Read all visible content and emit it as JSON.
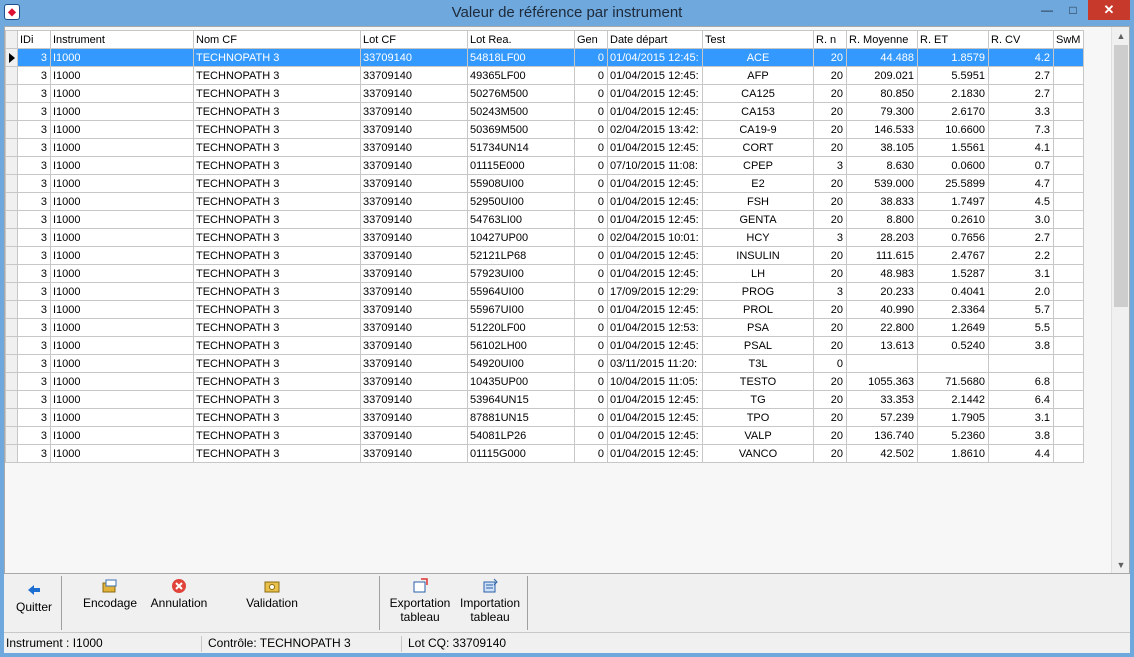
{
  "window": {
    "title": "Valeur de référence par instrument",
    "min_glyph": "—",
    "max_glyph": "□",
    "close_glyph": "✕"
  },
  "grid": {
    "columns": [
      "IDi",
      "Instrument",
      "Nom CF",
      "Lot CF",
      "Lot Rea.",
      "Gen",
      "Date départ",
      "Test",
      "R. n",
      "R. Moyenne",
      "R. ET",
      "R. CV",
      "SwM"
    ],
    "selected_row": 0,
    "rows": [
      [
        "3",
        "I1000",
        "TECHNOPATH 3",
        "33709140",
        "54818LF00",
        "0",
        "01/04/2015 12:45:",
        "ACE",
        "20",
        "44.488",
        "1.8579",
        "4.2",
        ""
      ],
      [
        "3",
        "I1000",
        "TECHNOPATH 3",
        "33709140",
        "49365LF00",
        "0",
        "01/04/2015 12:45:",
        "AFP",
        "20",
        "209.021",
        "5.5951",
        "2.7",
        ""
      ],
      [
        "3",
        "I1000",
        "TECHNOPATH 3",
        "33709140",
        "50276M500",
        "0",
        "01/04/2015 12:45:",
        "CA125",
        "20",
        "80.850",
        "2.1830",
        "2.7",
        ""
      ],
      [
        "3",
        "I1000",
        "TECHNOPATH 3",
        "33709140",
        "50243M500",
        "0",
        "01/04/2015 12:45:",
        "CA153",
        "20",
        "79.300",
        "2.6170",
        "3.3",
        ""
      ],
      [
        "3",
        "I1000",
        "TECHNOPATH 3",
        "33709140",
        "50369M500",
        "0",
        "02/04/2015 13:42:",
        "CA19-9",
        "20",
        "146.533",
        "10.6600",
        "7.3",
        ""
      ],
      [
        "3",
        "I1000",
        "TECHNOPATH 3",
        "33709140",
        "51734UN14",
        "0",
        "01/04/2015 12:45:",
        "CORT",
        "20",
        "38.105",
        "1.5561",
        "4.1",
        ""
      ],
      [
        "3",
        "I1000",
        "TECHNOPATH 3",
        "33709140",
        "01115E000",
        "0",
        "07/10/2015 11:08:",
        "CPEP",
        "3",
        "8.630",
        "0.0600",
        "0.7",
        ""
      ],
      [
        "3",
        "I1000",
        "TECHNOPATH 3",
        "33709140",
        "55908UI00",
        "0",
        "01/04/2015 12:45:",
        "E2",
        "20",
        "539.000",
        "25.5899",
        "4.7",
        ""
      ],
      [
        "3",
        "I1000",
        "TECHNOPATH 3",
        "33709140",
        "52950UI00",
        "0",
        "01/04/2015 12:45:",
        "FSH",
        "20",
        "38.833",
        "1.7497",
        "4.5",
        ""
      ],
      [
        "3",
        "I1000",
        "TECHNOPATH 3",
        "33709140",
        "54763LI00",
        "0",
        "01/04/2015 12:45:",
        "GENTA",
        "20",
        "8.800",
        "0.2610",
        "3.0",
        ""
      ],
      [
        "3",
        "I1000",
        "TECHNOPATH 3",
        "33709140",
        "10427UP00",
        "0",
        "02/04/2015 10:01:",
        "HCY",
        "3",
        "28.203",
        "0.7656",
        "2.7",
        ""
      ],
      [
        "3",
        "I1000",
        "TECHNOPATH 3",
        "33709140",
        "52121LP68",
        "0",
        "01/04/2015 12:45:",
        "INSULIN",
        "20",
        "111.615",
        "2.4767",
        "2.2",
        ""
      ],
      [
        "3",
        "I1000",
        "TECHNOPATH 3",
        "33709140",
        "57923UI00",
        "0",
        "01/04/2015 12:45:",
        "LH",
        "20",
        "48.983",
        "1.5287",
        "3.1",
        ""
      ],
      [
        "3",
        "I1000",
        "TECHNOPATH 3",
        "33709140",
        "55964UI00",
        "0",
        "17/09/2015 12:29:",
        "PROG",
        "3",
        "20.233",
        "0.4041",
        "2.0",
        ""
      ],
      [
        "3",
        "I1000",
        "TECHNOPATH 3",
        "33709140",
        "55967UI00",
        "0",
        "01/04/2015 12:45:",
        "PROL",
        "20",
        "40.990",
        "2.3364",
        "5.7",
        ""
      ],
      [
        "3",
        "I1000",
        "TECHNOPATH 3",
        "33709140",
        "51220LF00",
        "0",
        "01/04/2015 12:53:",
        "PSA",
        "20",
        "22.800",
        "1.2649",
        "5.5",
        ""
      ],
      [
        "3",
        "I1000",
        "TECHNOPATH 3",
        "33709140",
        "56102LH00",
        "0",
        "01/04/2015 12:45:",
        "PSAL",
        "20",
        "13.613",
        "0.5240",
        "3.8",
        ""
      ],
      [
        "3",
        "I1000",
        "TECHNOPATH 3",
        "33709140",
        "54920UI00",
        "0",
        "03/11/2015 11:20:",
        "T3L",
        "0",
        "",
        "",
        "",
        ""
      ],
      [
        "3",
        "I1000",
        "TECHNOPATH 3",
        "33709140",
        "10435UP00",
        "0",
        "10/04/2015 11:05:",
        "TESTO",
        "20",
        "1055.363",
        "71.5680",
        "6.8",
        ""
      ],
      [
        "3",
        "I1000",
        "TECHNOPATH 3",
        "33709140",
        "53964UN15",
        "0",
        "01/04/2015 12:45:",
        "TG",
        "20",
        "33.353",
        "2.1442",
        "6.4",
        ""
      ],
      [
        "3",
        "I1000",
        "TECHNOPATH 3",
        "33709140",
        "87881UN15",
        "0",
        "01/04/2015 12:45:",
        "TPO",
        "20",
        "57.239",
        "1.7905",
        "3.1",
        ""
      ],
      [
        "3",
        "I1000",
        "TECHNOPATH 3",
        "33709140",
        "54081LP26",
        "0",
        "01/04/2015 12:45:",
        "VALP",
        "20",
        "136.740",
        "5.2360",
        "3.8",
        ""
      ],
      [
        "3",
        "I1000",
        "TECHNOPATH 3",
        "33709140",
        "01115G000",
        "0",
        "01/04/2015 12:45:",
        "VANCO",
        "20",
        "42.502",
        "1.8610",
        "4.4",
        ""
      ]
    ]
  },
  "toolbar": {
    "quitter": "Quitter",
    "encodage": "Encodage",
    "annulation": "Annulation",
    "validation": "Validation",
    "exportation_l1": "Exportation",
    "exportation_l2": "tableau",
    "importation_l1": "Importation",
    "importation_l2": "tableau"
  },
  "status": {
    "instrument": "Instrument : I1000",
    "controle": "Contrôle: TECHNOPATH 3",
    "lot": "Lot CQ: 33709140"
  },
  "colors": {
    "accent": "#3399ff",
    "titlebar": "#6fa8dc",
    "close": "#c7392b"
  }
}
